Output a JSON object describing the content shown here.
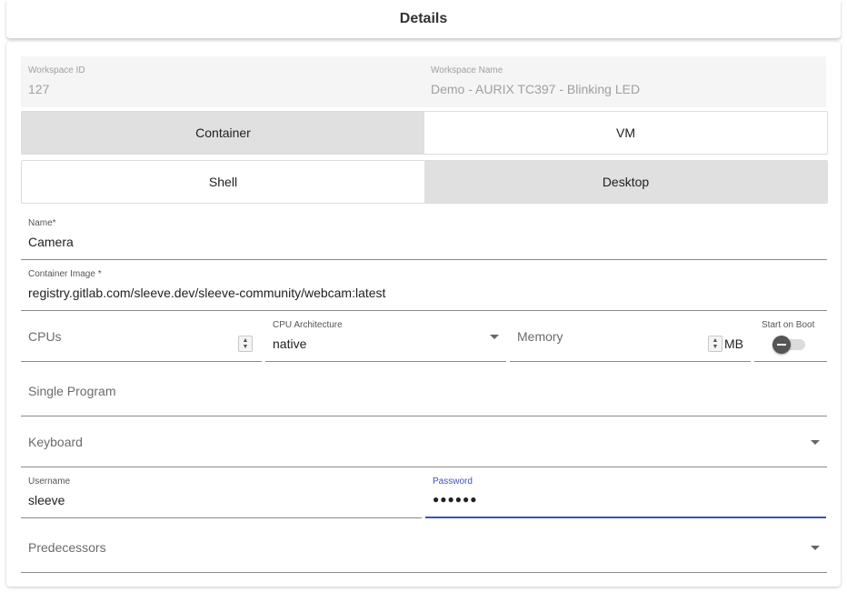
{
  "header": {
    "title": "Details"
  },
  "workspace": {
    "id_label": "Workspace ID",
    "id_value": "127",
    "name_label": "Workspace Name",
    "name_value": "Demo - AURIX TC397 - Blinking LED"
  },
  "type_toggle": {
    "options": [
      "Container",
      "VM"
    ],
    "selected": "Container"
  },
  "mode_toggle": {
    "options": [
      "Shell",
      "Desktop"
    ],
    "selected": "Desktop"
  },
  "form": {
    "name": {
      "label": "Name*",
      "value": "Camera"
    },
    "image": {
      "label": "Container Image *",
      "value": "registry.gitlab.com/sleeve.dev/sleeve-community/webcam:latest"
    },
    "cpus": {
      "placeholder": "CPUs"
    },
    "arch": {
      "label": "CPU Architecture",
      "value": "native"
    },
    "memory": {
      "placeholder": "Memory",
      "suffix": "MB"
    },
    "start_on_boot": {
      "label": "Start on Boot",
      "checked": false
    },
    "single_program": {
      "placeholder": "Single Program"
    },
    "keyboard": {
      "placeholder": "Keyboard"
    },
    "username": {
      "label": "Username",
      "value": "sleeve"
    },
    "password": {
      "label": "Password",
      "value": "●●●●●●"
    },
    "predecessors": {
      "placeholder": "Predecessors"
    }
  },
  "colors": {
    "accent": "#3f51b5",
    "segment_active": "#e0e0e0",
    "readonly_bg": "#f5f5f5"
  },
  "icons": {
    "dropdown": "chevron-down-icon",
    "spinner": "up-down-spinner-icon",
    "toggle": "switch-icon"
  }
}
